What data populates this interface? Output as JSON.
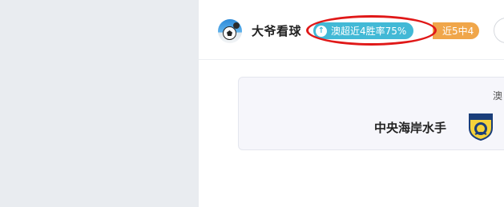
{
  "user": {
    "name": "大爷看球",
    "avatar_icon": "soccer-player-avatar"
  },
  "badges": {
    "win_rate": "澳超近4胜率75%",
    "win_rate_icon": "arrow-up-icon",
    "recent_record": "近5中4"
  },
  "match": {
    "league_partial": "澳",
    "team_name": "中央海岸水手",
    "team_logo_icon": "mariners-crest-icon"
  },
  "colors": {
    "win_rate_badge": "#42b9d6",
    "record_badge": "#f0a64a",
    "highlight": "#e01818",
    "left_panel": "#e9ecf0"
  }
}
